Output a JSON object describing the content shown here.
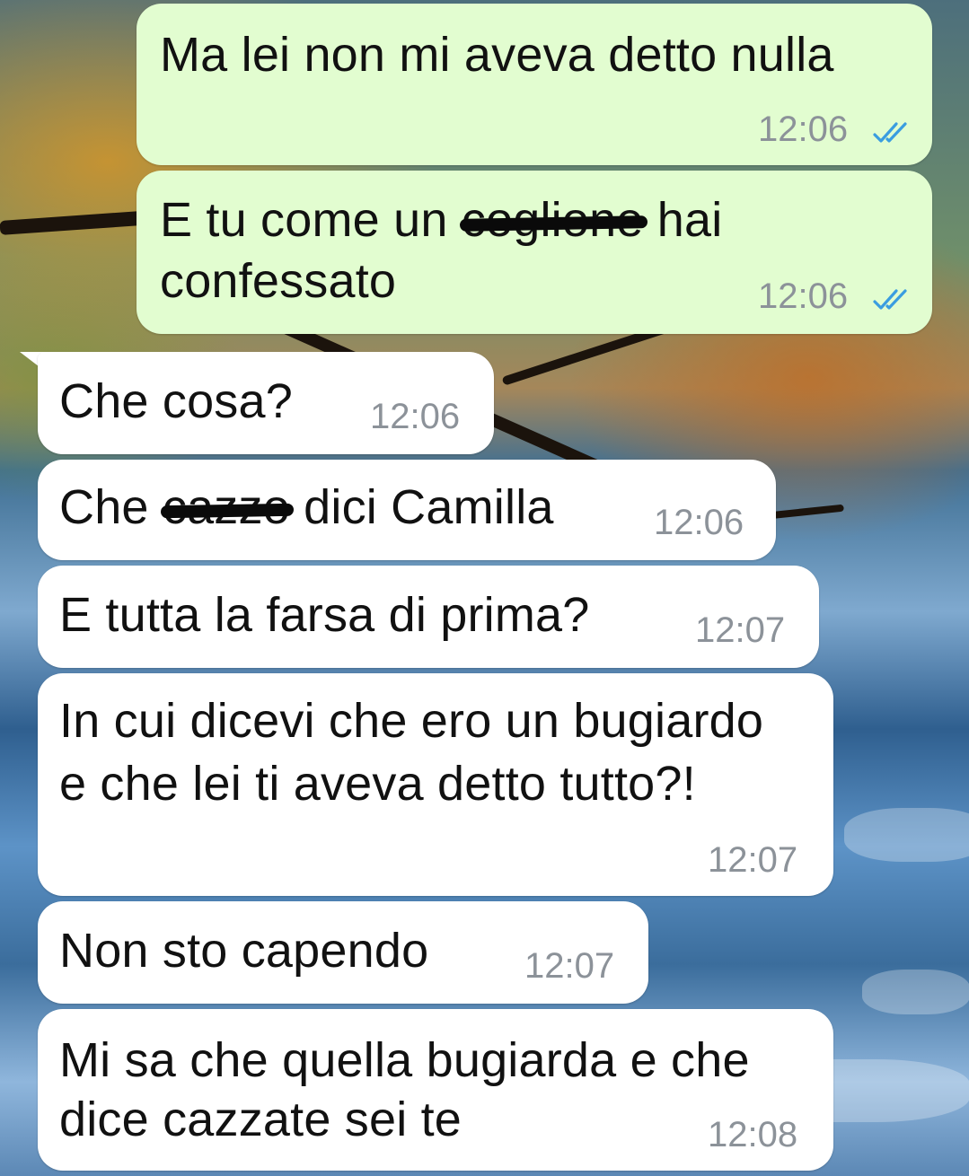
{
  "messages": [
    {
      "direction": "out",
      "parts": [
        "Ma lei non mi aveva detto nulla"
      ],
      "time": "12:06",
      "status": "read-double-check-icon"
    },
    {
      "direction": "out",
      "parts": [
        "E tu come un ",
        "coglione",
        " hai",
        "confessato"
      ],
      "time": "12:06",
      "status": "read-double-check-icon"
    },
    {
      "direction": "in",
      "parts": [
        "Che cosa?"
      ],
      "time": "12:06"
    },
    {
      "direction": "in",
      "parts": [
        "Che ",
        "cazzo",
        " dici Camilla"
      ],
      "time": "12:06"
    },
    {
      "direction": "in",
      "parts": [
        "E tutta la farsa di prima?"
      ],
      "time": "12:07"
    },
    {
      "direction": "in",
      "parts": [
        "In cui dicevi che ero un bugiardo",
        "e che lei ti aveva detto tutto?!"
      ],
      "time": "12:07"
    },
    {
      "direction": "in",
      "parts": [
        "Non sto capendo"
      ],
      "time": "12:07"
    },
    {
      "direction": "in",
      "parts": [
        "Mi sa che quella bugiarda e che",
        "dice cazzate sei te"
      ],
      "time": "12:08"
    }
  ],
  "colors": {
    "outgoing": "#e2fdd0",
    "incoming": "#ffffff",
    "tick": "#3a9de0",
    "time": "#8c9299"
  }
}
